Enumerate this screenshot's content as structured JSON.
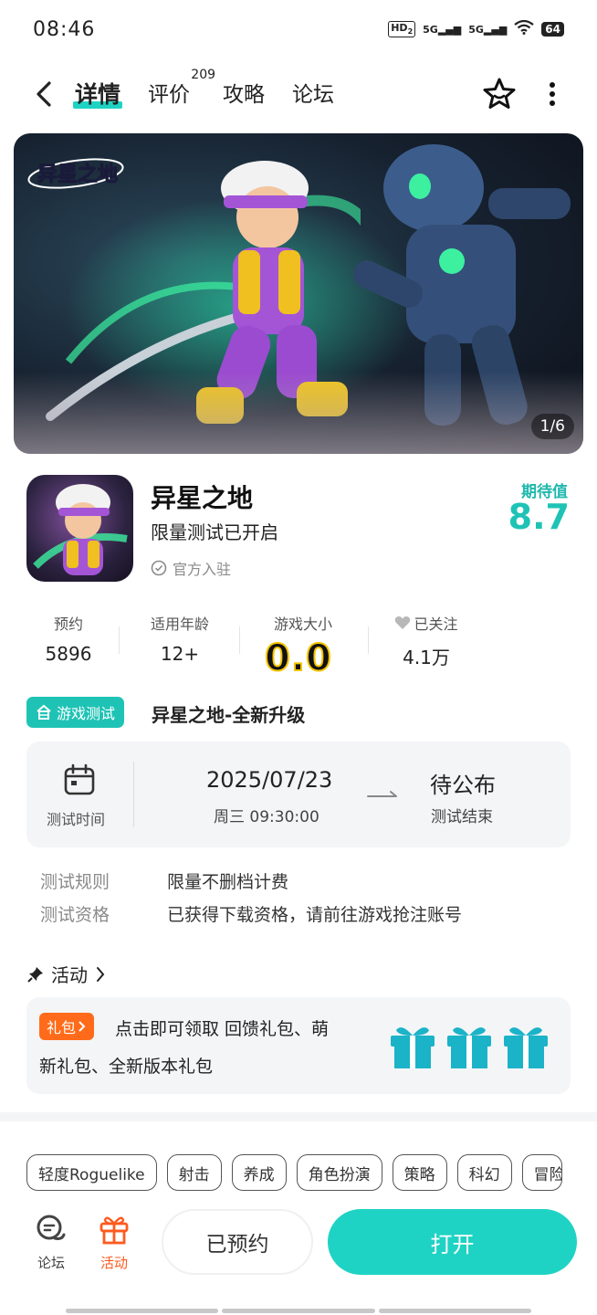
{
  "status_bar": {
    "time": "08:46",
    "hd": "HD",
    "hd_sub": "2",
    "signal1": "5G",
    "signal2": "5G",
    "battery": "64"
  },
  "nav": {
    "tabs": [
      {
        "label": "详情",
        "active": true
      },
      {
        "label": "评价",
        "badge": "209"
      },
      {
        "label": "攻略"
      },
      {
        "label": "论坛"
      }
    ],
    "icons": [
      "back-icon",
      "star-icon",
      "more-icon"
    ]
  },
  "banner": {
    "logo_text": "异星之地",
    "counter": "1/6"
  },
  "app": {
    "name": "异星之地",
    "subtitle": "限量测试已开启",
    "official": "官方入驻",
    "rating_label": "期待值",
    "rating_value": "8.7"
  },
  "stats": {
    "reserve_label": "预约",
    "reserve_value": "5896",
    "age_label": "适用年龄",
    "age_value": "12+",
    "size_label": "游戏大小",
    "size_value": "0.0",
    "follow_label": "已关注",
    "follow_value": "4.1万"
  },
  "test": {
    "badge": "游戏测试",
    "title": "异星之地-全新升级",
    "time_label": "测试时间",
    "date": "2025/07/23",
    "weekday_time": "周三  09:30:00",
    "end_value": "待公布",
    "end_label": "测试结束",
    "rules": [
      {
        "label": "测试规则",
        "value": "限量不删档计费"
      },
      {
        "label": "测试资格",
        "value": "已获得下载资格，请前往游戏抢注账号"
      }
    ]
  },
  "activity": {
    "header": "活动",
    "gift_tag": "礼包",
    "text_line1": "点击即可领取 回馈礼包、萌",
    "text_line2": "新礼包、全新版本礼包"
  },
  "tags": [
    "轻度Roguelike",
    "射击",
    "养成",
    "角色扮演",
    "策略",
    "科幻",
    "冒险"
  ],
  "bottom": {
    "forum_label": "论坛",
    "activity_label": "活动",
    "reserved_btn": "已预约",
    "open_btn": "打开"
  },
  "colors": {
    "accent": "#1fd3c4",
    "accent_dark": "#1fc3b5",
    "gift_orange": "#ff6b1a",
    "activity_orange": "#ff5a1f"
  }
}
